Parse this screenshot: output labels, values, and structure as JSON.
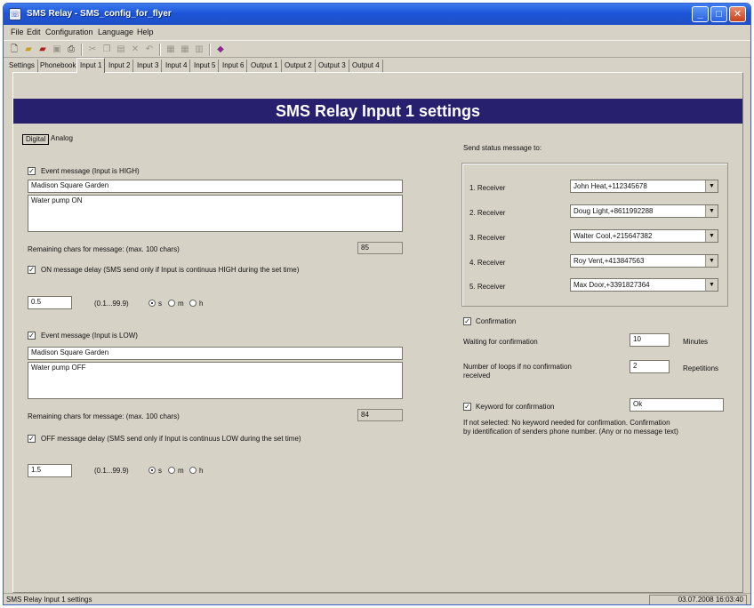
{
  "window": {
    "title": "SMS Relay - SMS_config_for_flyer",
    "controls": {
      "minimize": "_",
      "maximize": "□",
      "close": "✕"
    }
  },
  "menu": [
    "File",
    "Edit",
    "Configuration",
    "Language",
    "Help"
  ],
  "tabs": [
    "Settings",
    "Phonebook",
    "Input 1",
    "Input 2",
    "Input 3",
    "Input 4",
    "Input 5",
    "Input 6",
    "Output 1",
    "Output 2",
    "Output 3",
    "Output 4"
  ],
  "page_title": "SMS Relay Input 1 settings",
  "subtabs": [
    "Digital",
    "Analog"
  ],
  "high": {
    "event_label": "Event message (Input is HIGH)",
    "location": "Madison Square Garden",
    "message": "Water pump ON",
    "remaining_label": "Remaining chars for message: (max. 100 chars)",
    "remaining_value": "85",
    "delay_label": "ON message delay (SMS send only if Input is continuus HIGH during the set time)",
    "delay_value": "0.5",
    "range": "(0.1...99.9)",
    "units": [
      "s",
      "m",
      "h"
    ]
  },
  "low": {
    "event_label": "Event message (Input is LOW)",
    "location": "Madison Square Garden",
    "message": "Water pump OFF",
    "remaining_label": "Remaining chars for message: (max. 100 chars)",
    "remaining_value": "84",
    "delay_label": "OFF message delay (SMS send only if Input is continuus  LOW during the set time)",
    "delay_value": "1.5",
    "range": "(0.1...99.9)",
    "units": [
      "s",
      "m",
      "h"
    ]
  },
  "status_msg": {
    "label": "Send status message to:",
    "receivers": [
      {
        "label": "1. Receiver",
        "value": "John Heat,+112345678"
      },
      {
        "label": "2. Receiver",
        "value": "Doug Light,+8611992288"
      },
      {
        "label": "3. Receiver",
        "value": "Walter Cool,+215647382"
      },
      {
        "label": "4. Receiver",
        "value": "Roy Vent,+413847563"
      },
      {
        "label": "5. Receiver",
        "value": "Max Door,+3391827364"
      }
    ]
  },
  "confirmation": {
    "label": "Confirmation",
    "waiting_label": "Waiting for confirmation",
    "waiting_value": "10",
    "waiting_unit": "Minutes",
    "loops_label_1": "Number of loops if no confirmation",
    "loops_label_2": "received",
    "loops_value": "2",
    "loops_unit": "Repetitions",
    "keyword_label": "Keyword for confirmation",
    "keyword_value": "Ok",
    "note_1": "If not selected: No keyword needed for confirmation.  Confirmation",
    "note_2": "by identification of senders phone number. (Any or no message text)"
  },
  "statusbar": {
    "left": "SMS Relay Input 1 settings",
    "right": "03.07.2008 16:03:40"
  },
  "glyphs": {
    "check": "✓",
    "dropdown": "▼",
    "app_icon": "☏"
  }
}
